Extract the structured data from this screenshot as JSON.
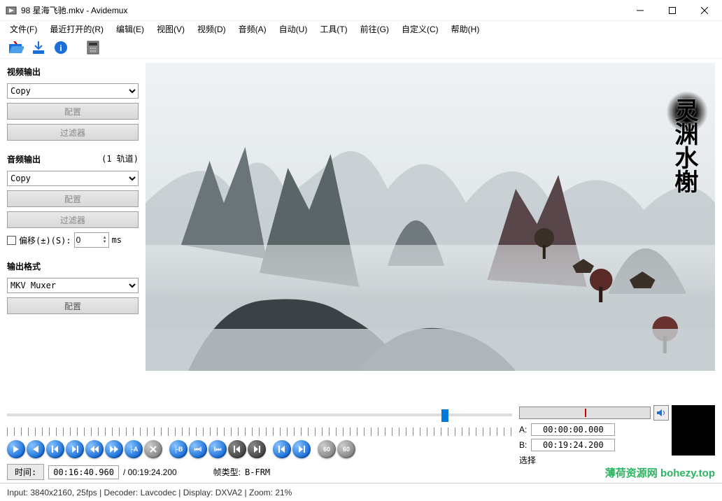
{
  "window": {
    "title": "98 星海飞驰.mkv - Avidemux"
  },
  "menu": {
    "items": [
      "文件(F)",
      "最近打开的(R)",
      "编辑(E)",
      "视图(V)",
      "视频(D)",
      "音频(A)",
      "自动(U)",
      "工具(T)",
      "前往(G)",
      "自定义(C)",
      "帮助(H)"
    ]
  },
  "sidebar": {
    "video_out": {
      "label": "视频输出",
      "combo": "Copy",
      "config": "配置",
      "filter": "过滤器"
    },
    "audio_out": {
      "label": "音频输出",
      "tracks": "(1 轨道)",
      "combo": "Copy",
      "config": "配置",
      "filter": "过滤器",
      "offset_label": "偏移(±)(S):",
      "offset_value": "0",
      "offset_unit": "ms"
    },
    "out_fmt": {
      "label": "输出格式",
      "combo": "MKV Muxer",
      "config": "配置"
    }
  },
  "preview": {
    "watermark_text": "灵渊水榭"
  },
  "timeline": {
    "time_btn": "时间:",
    "time_value": "00:16:40.960",
    "duration": "/ 00:19:24.200",
    "frame_label": "帧类型:",
    "frame_value": "B-FRM"
  },
  "ab": {
    "a_label": "A:",
    "a_value": "00:00:00.000",
    "b_label": "B:",
    "b_value": "00:19:24.200",
    "select_label": "选择"
  },
  "status": {
    "text": "Input: 3840x2160, 25fps  |  Decoder: Lavcodec  |  Display: DXVA2  |  Zoom: 21%"
  },
  "brand": {
    "text": "薄荷资源网  bohezy.top"
  }
}
